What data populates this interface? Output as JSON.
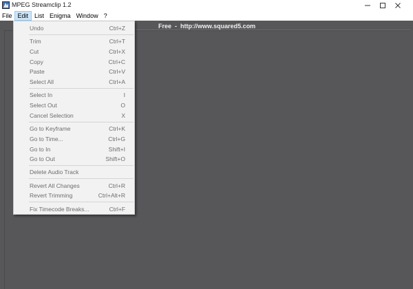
{
  "window": {
    "title": "MPEG Streamclip 1.2",
    "controls": [
      "minimize",
      "maximize",
      "close"
    ]
  },
  "menubar": {
    "items": [
      {
        "label": "File",
        "active": false
      },
      {
        "label": "Edit",
        "active": true
      },
      {
        "label": "List",
        "active": false
      },
      {
        "label": "Enigma",
        "active": false
      },
      {
        "label": "Window",
        "active": false
      },
      {
        "label": "?",
        "active": false
      }
    ]
  },
  "banner": {
    "text": "Free  -  http://www.squared5.com"
  },
  "edit_menu": {
    "items": [
      {
        "label": "Undo",
        "shortcut": "Ctrl+Z",
        "enabled": false
      },
      {
        "label": "Trim",
        "shortcut": "Ctrl+T",
        "enabled": false
      },
      {
        "label": "Cut",
        "shortcut": "Ctrl+X",
        "enabled": false
      },
      {
        "label": "Copy",
        "shortcut": "Ctrl+C",
        "enabled": false
      },
      {
        "label": "Paste",
        "shortcut": "Ctrl+V",
        "enabled": false
      },
      {
        "label": "Select All",
        "shortcut": "Ctrl+A",
        "enabled": false
      },
      {
        "label": "Select In",
        "shortcut": "I",
        "enabled": false
      },
      {
        "label": "Select Out",
        "shortcut": "O",
        "enabled": false
      },
      {
        "label": "Cancel Selection",
        "shortcut": "X",
        "enabled": false
      },
      {
        "label": "Go to Keyframe",
        "shortcut": "Ctrl+K",
        "enabled": false
      },
      {
        "label": "Go to Time...",
        "shortcut": "Ctrl+G",
        "enabled": false
      },
      {
        "label": "Go to In",
        "shortcut": "Shift+I",
        "enabled": false
      },
      {
        "label": "Go to Out",
        "shortcut": "Shift+O",
        "enabled": false
      },
      {
        "label": "Delete Audio Track",
        "shortcut": "",
        "enabled": false
      },
      {
        "label": "Revert All Changes",
        "shortcut": "Ctrl+R",
        "enabled": false
      },
      {
        "label": "Revert Trimming",
        "shortcut": "Ctrl+Alt+R",
        "enabled": false
      },
      {
        "label": "Fix Timecode Breaks...",
        "shortcut": "Ctrl+F",
        "enabled": false
      }
    ]
  },
  "colors": {
    "background": "#57575a",
    "menu_background": "#f2f2f2",
    "disabled_text": "#6d6d6d",
    "active_menu_highlight": "#cce4f7",
    "banner_text": "#f0f0f0"
  }
}
